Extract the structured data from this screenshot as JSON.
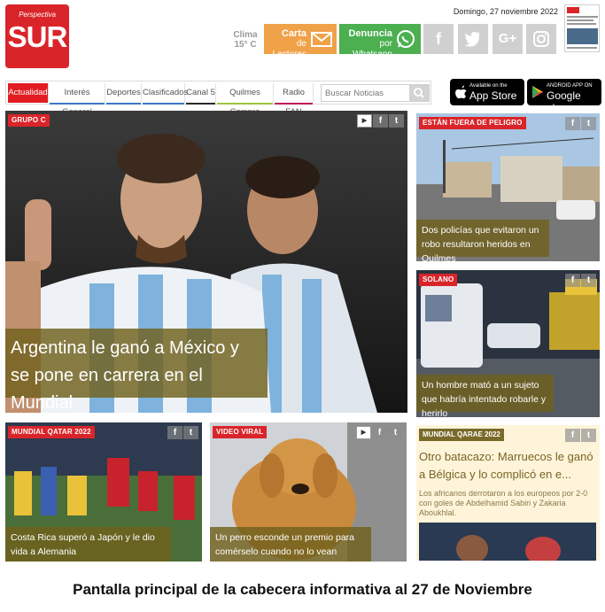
{
  "header": {
    "logo_tagline": "Perspectiva",
    "logo_name": "SUR",
    "weather_label": "Clima",
    "weather_temp": "15° C",
    "date": "Domingo, 27 noviembre 2022",
    "letters_button": {
      "line1": "Carta",
      "line2": "de Lectores"
    },
    "whatsapp_button": {
      "line1": "Denuncia",
      "line2": "por Whatsapp"
    },
    "social": [
      {
        "icon": "facebook-icon",
        "glyph": "f"
      },
      {
        "icon": "twitter-icon",
        "glyph": "t"
      },
      {
        "icon": "google-plus-icon",
        "glyph": "G+"
      },
      {
        "icon": "instagram-icon",
        "glyph": "◎"
      }
    ]
  },
  "nav": {
    "items": [
      {
        "label": "Actualidad",
        "active": true,
        "underline": ""
      },
      {
        "label": "Interés General",
        "active": false,
        "underline": "#3b78c4"
      },
      {
        "label": "Deportes",
        "active": false,
        "underline": "#3b78c4"
      },
      {
        "label": "Clasificados",
        "active": false,
        "underline": "#3b78c4"
      },
      {
        "label": "Canal 5",
        "active": false,
        "underline": "#2a2a2a"
      },
      {
        "label": "Quilmes Compra",
        "active": false,
        "underline": "#9bc53d"
      },
      {
        "label": "Radio FAN",
        "active": false,
        "underline": "#c2185b"
      }
    ],
    "search_placeholder": "Buscar Noticias"
  },
  "stores": {
    "apple": {
      "small": "Available on the",
      "large": "App Store"
    },
    "google": {
      "small": "ANDROID APP ON",
      "large": "Google play"
    }
  },
  "articles": {
    "main": {
      "tag": "GRUPO C",
      "title": "Argentina le ganó a México y se pone en carrera en el Mundial"
    },
    "right1": {
      "tag": "ESTÁN FUERA DE PELIGRO",
      "title": "Dos policías que evitaron un robo resultaron heridos en Quilmes"
    },
    "right2": {
      "tag": "SOLANO",
      "title": "Un hombre mató a un sujeto que habría intentado robarle y herirlo"
    },
    "bottom1": {
      "tag": "MUNDIAL QATAR 2022",
      "title": "Costa Rica superó a Japón y le dio vida a Alemania"
    },
    "bottom2": {
      "tag": "VIDEO VIRAL",
      "title": "Un perro esconde un premio para comérselo cuando no lo vean"
    },
    "right3": {
      "tag": "MUNDIAL QARAE 2022",
      "title": "Otro batacazo: Marruecos le ganó a Bélgica y lo complicó en e...",
      "summary": "Los africanos derrotaron a los europeos por 2-0 con goles de Abdelhamid Sabiri y Zakaria Aboukhlal."
    }
  },
  "caption": "Pantalla principal de la cabecera informativa al 27 de Noviembre",
  "colors": {
    "brand_red": "#d9252a",
    "cta_orange": "#f0a249",
    "cta_green": "#4caf50",
    "headline_olive": "#70601c"
  }
}
